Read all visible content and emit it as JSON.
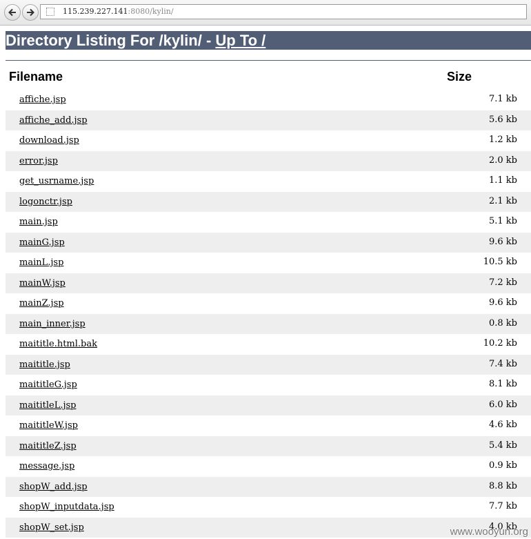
{
  "browser": {
    "url_host": "115.239.227.141",
    "url_rest": ":8080/kylin/"
  },
  "page": {
    "heading_text": "Directory Listing For /kylin/ - ",
    "up_link": "Up To /",
    "col_filename": "Filename",
    "col_size": "Size"
  },
  "files": [
    {
      "name": "affiche.jsp",
      "size": "7.1 kb"
    },
    {
      "name": "affiche_add.jsp",
      "size": "5.6 kb"
    },
    {
      "name": "download.jsp",
      "size": "1.2 kb"
    },
    {
      "name": "error.jsp",
      "size": "2.0 kb"
    },
    {
      "name": "get_usrname.jsp",
      "size": "1.1 kb"
    },
    {
      "name": "logonctr.jsp",
      "size": "2.1 kb"
    },
    {
      "name": "main.jsp",
      "size": "5.1 kb"
    },
    {
      "name": "mainG.jsp",
      "size": "9.6 kb"
    },
    {
      "name": "mainL.jsp",
      "size": "10.5 kb"
    },
    {
      "name": "mainW.jsp",
      "size": "7.2 kb"
    },
    {
      "name": "mainZ.jsp",
      "size": "9.6 kb"
    },
    {
      "name": "main_inner.jsp",
      "size": "0.8 kb"
    },
    {
      "name": "maititle.html.bak",
      "size": "10.2 kb"
    },
    {
      "name": "maititle.jsp",
      "size": "7.4 kb"
    },
    {
      "name": "maititleG.jsp",
      "size": "8.1 kb"
    },
    {
      "name": "maititleL.jsp",
      "size": "6.0 kb"
    },
    {
      "name": "maititleW.jsp",
      "size": "4.6 kb"
    },
    {
      "name": "maititleZ.jsp",
      "size": "5.4 kb"
    },
    {
      "name": "message.jsp",
      "size": "0.9 kb"
    },
    {
      "name": "shopW_add.jsp",
      "size": "8.8 kb"
    },
    {
      "name": "shopW_inputdata.jsp",
      "size": "7.7 kb"
    },
    {
      "name": "shopW_set.jsp",
      "size": "4.0 kb"
    }
  ],
  "watermark": "www.wooyun.org"
}
